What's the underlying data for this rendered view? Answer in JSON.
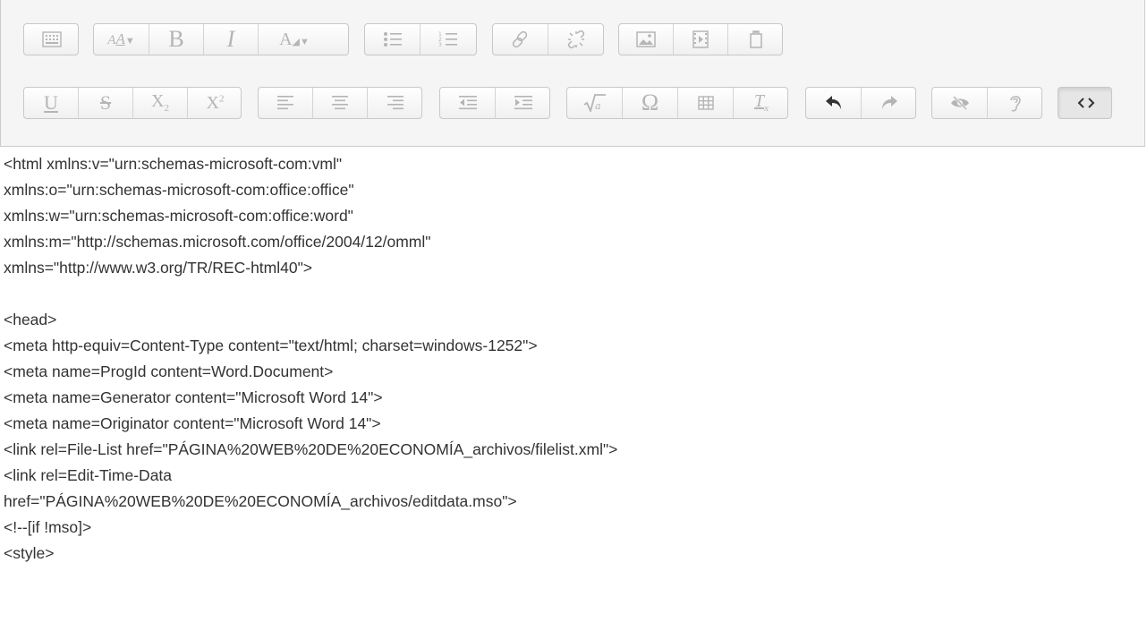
{
  "toolbar": {
    "row1": [
      {
        "group": "toggle",
        "buttons": [
          {
            "name": "show-more-buttons",
            "icon": "kitchen-sink-icon"
          }
        ]
      },
      {
        "group": "text",
        "buttons": [
          {
            "name": "font-style",
            "icon": "font-style-icon",
            "label": "A"
          },
          {
            "name": "bold",
            "icon": "bold-icon",
            "label": "B"
          },
          {
            "name": "italic",
            "icon": "italic-icon",
            "label": "I"
          },
          {
            "name": "font-color",
            "icon": "font-color-icon",
            "label": "A"
          }
        ]
      },
      {
        "group": "lists",
        "buttons": [
          {
            "name": "unordered-list",
            "icon": "bullet-list-icon"
          },
          {
            "name": "ordered-list",
            "icon": "numbered-list-icon"
          }
        ]
      },
      {
        "group": "links",
        "buttons": [
          {
            "name": "link",
            "icon": "link-icon"
          },
          {
            "name": "unlink",
            "icon": "unlink-icon"
          }
        ]
      },
      {
        "group": "files",
        "buttons": [
          {
            "name": "image",
            "icon": "image-icon"
          },
          {
            "name": "media",
            "icon": "media-icon"
          },
          {
            "name": "manage-files",
            "icon": "manage-files-icon"
          }
        ]
      }
    ],
    "row2": [
      {
        "group": "style",
        "buttons": [
          {
            "name": "underline",
            "icon": "underline-icon",
            "label": "U"
          },
          {
            "name": "strikethrough",
            "icon": "strikethrough-icon",
            "label": "S"
          },
          {
            "name": "subscript",
            "icon": "subscript-icon",
            "label": "X",
            "sub": "2"
          },
          {
            "name": "superscript",
            "icon": "superscript-icon",
            "label": "X",
            "sup": "2"
          }
        ]
      },
      {
        "group": "align",
        "buttons": [
          {
            "name": "align-left",
            "icon": "align-left-icon"
          },
          {
            "name": "align-center",
            "icon": "align-center-icon"
          },
          {
            "name": "align-right",
            "icon": "align-right-icon"
          }
        ]
      },
      {
        "group": "indent",
        "buttons": [
          {
            "name": "outdent",
            "icon": "outdent-icon"
          },
          {
            "name": "indent",
            "icon": "indent-icon"
          }
        ]
      },
      {
        "group": "insert",
        "buttons": [
          {
            "name": "equation",
            "icon": "equation-icon"
          },
          {
            "name": "special-character",
            "icon": "omega-icon",
            "label": "Ω"
          },
          {
            "name": "table",
            "icon": "table-icon"
          },
          {
            "name": "clear-formatting",
            "icon": "clear-formatting-icon",
            "label": "T",
            "sub": "x"
          }
        ]
      },
      {
        "group": "undo",
        "buttons": [
          {
            "name": "undo",
            "icon": "undo-icon"
          },
          {
            "name": "redo",
            "icon": "redo-icon"
          }
        ]
      },
      {
        "group": "accessibility",
        "buttons": [
          {
            "name": "accessibility-checker",
            "icon": "eye-slash-icon"
          },
          {
            "name": "screenreader-helper",
            "icon": "ear-icon"
          }
        ]
      },
      {
        "group": "other",
        "buttons": [
          {
            "name": "html",
            "icon": "code-icon"
          }
        ]
      }
    ]
  },
  "source_lines": [
    "<html xmlns:v=\"urn:schemas-microsoft-com:vml\"",
    "xmlns:o=\"urn:schemas-microsoft-com:office:office\"",
    "xmlns:w=\"urn:schemas-microsoft-com:office:word\"",
    "xmlns:m=\"http://schemas.microsoft.com/office/2004/12/omml\"",
    "xmlns=\"http://www.w3.org/TR/REC-html40\">",
    "",
    "<head>",
    "<meta http-equiv=Content-Type content=\"text/html; charset=windows-1252\">",
    "<meta name=ProgId content=Word.Document>",
    "<meta name=Generator content=\"Microsoft Word 14\">",
    "<meta name=Originator content=\"Microsoft Word 14\">",
    "<link rel=File-List href=\"PÁGINA%20WEB%20DE%20ECONOMÍA_archivos/filelist.xml\">",
    "<link rel=Edit-Time-Data",
    "href=\"PÁGINA%20WEB%20DE%20ECONOMÍA_archivos/editdata.mso\">",
    "<!--[if !mso]>",
    "<style>"
  ]
}
